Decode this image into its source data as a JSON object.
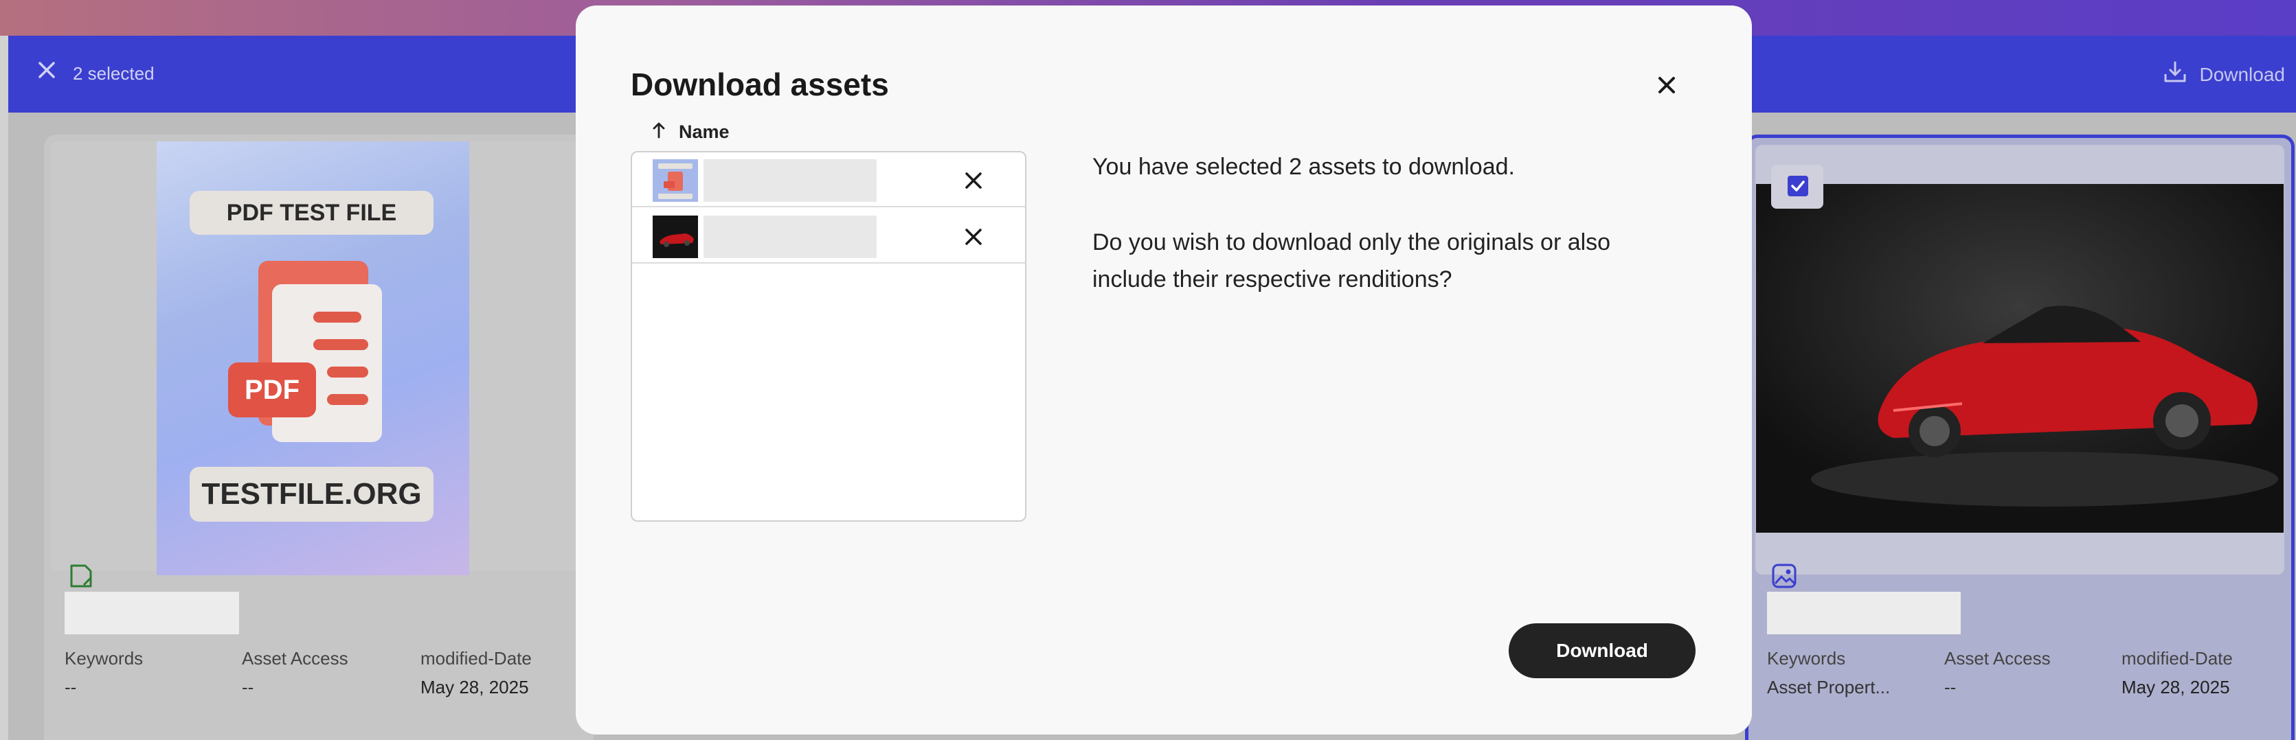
{
  "selection_bar": {
    "selected_text": "2 selected",
    "download_label": "Download"
  },
  "cards": {
    "left": {
      "thumb": {
        "title": "PDF TEST FILE",
        "badge": "PDF",
        "footer": "TESTFILE.ORG"
      },
      "meta_labels": [
        "Keywords",
        "Asset Access",
        "modified-Date"
      ],
      "meta_values": [
        "--",
        "--",
        "May 28, 2025"
      ]
    },
    "right": {
      "meta_labels": [
        "Keywords",
        "Asset Access",
        "modified-Date"
      ],
      "meta_values": [
        "Asset Propert...",
        "--",
        "May 28, 2025"
      ]
    }
  },
  "modal": {
    "title": "Download assets",
    "column_header": "Name",
    "message_1": "You have selected 2 assets to download.",
    "message_2": "Do you wish to download only the originals or also include their respective renditions?",
    "download_button": "Download"
  },
  "colors": {
    "accent": "#3b3fcf",
    "button_dark": "#232323",
    "file_icon_green": "#2e7d32"
  },
  "icons": [
    "close-icon",
    "download-icon",
    "document-icon",
    "image-icon",
    "sort-arrow-up-icon",
    "remove-icon",
    "checkbox-checked-icon"
  ]
}
